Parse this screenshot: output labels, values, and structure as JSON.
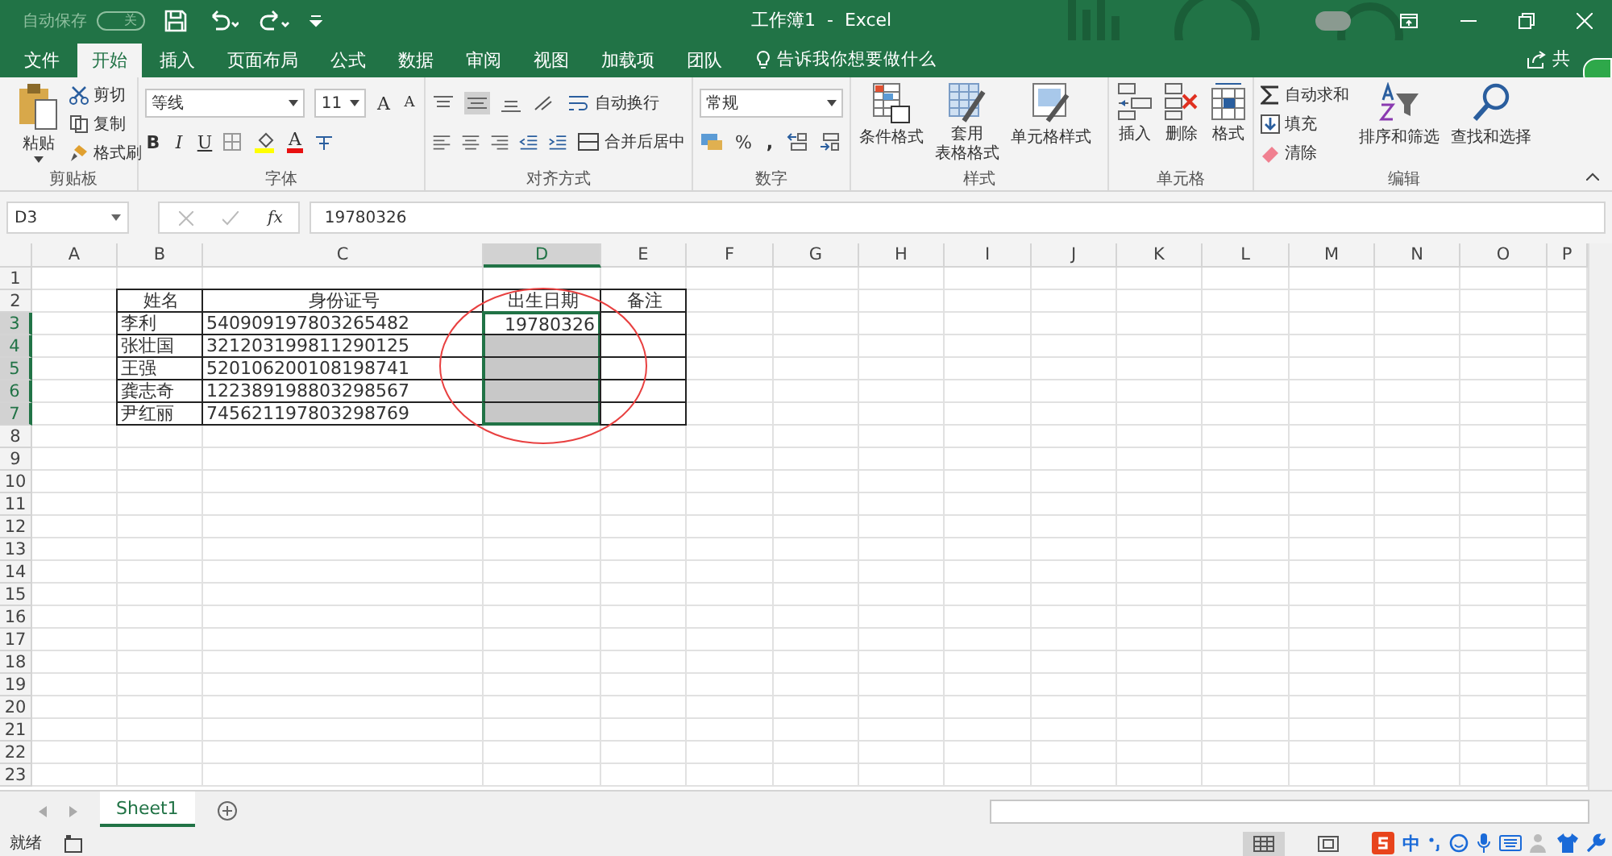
{
  "title_bar": {
    "autosave_label": "自动保存",
    "autosave_toggle": "关",
    "autosave_on": false,
    "title": "工作簿1  -  Excel"
  },
  "tabs": [
    {
      "label": "文件",
      "selected": false
    },
    {
      "label": "开始",
      "selected": true
    },
    {
      "label": "插入",
      "selected": false
    },
    {
      "label": "页面布局",
      "selected": false
    },
    {
      "label": "公式",
      "selected": false
    },
    {
      "label": "数据",
      "selected": false
    },
    {
      "label": "审阅",
      "selected": false
    },
    {
      "label": "视图",
      "selected": false
    },
    {
      "label": "加载项",
      "selected": false
    },
    {
      "label": "团队",
      "selected": false
    }
  ],
  "tell_me": "告诉我你想要做什么",
  "share": "共",
  "clipboard": {
    "label": "剪贴板",
    "paste": "粘贴",
    "cut": "剪切",
    "copy": "复制",
    "format_painter": "格式刷"
  },
  "font": {
    "label": "字体",
    "font_name": "等线",
    "font_size": "11",
    "grow_font": "A",
    "shrink_font": "A",
    "bold": "B",
    "italic": "I",
    "underline": "U",
    "font_color": "A"
  },
  "alignment": {
    "label": "对齐方式",
    "wrap": "自动换行",
    "merge": "合并后居中"
  },
  "number": {
    "label": "数字",
    "format": "常规",
    "percent": "%",
    "comma": ","
  },
  "styles": {
    "label": "样式",
    "conditional": "条件格式",
    "table_format": [
      "套用",
      "表格格式"
    ],
    "cell_styles": "单元格样式"
  },
  "cells": {
    "label": "单元格",
    "insert": "插入",
    "delete": "删除",
    "format": "格式"
  },
  "editing": {
    "label": "编辑",
    "autosum": "自动求和",
    "fill": "填充",
    "clear": "清除",
    "sort": "排序和筛选",
    "find": "查找和选择"
  },
  "name_box": "D3",
  "fx_label": "fx",
  "formula": "19780326",
  "columns": [
    {
      "label": "A",
      "selected": false
    },
    {
      "label": "B",
      "selected": false
    },
    {
      "label": "C",
      "selected": false
    },
    {
      "label": "D",
      "selected": true
    },
    {
      "label": "E",
      "selected": false
    },
    {
      "label": "F",
      "selected": false
    },
    {
      "label": "G",
      "selected": false
    },
    {
      "label": "H",
      "selected": false
    },
    {
      "label": "I",
      "selected": false
    },
    {
      "label": "J",
      "selected": false
    },
    {
      "label": "K",
      "selected": false
    },
    {
      "label": "L",
      "selected": false
    },
    {
      "label": "M",
      "selected": false
    },
    {
      "label": "N",
      "selected": false
    },
    {
      "label": "O",
      "selected": false
    },
    {
      "label": "P",
      "selected": false
    }
  ],
  "row_headers": [
    {
      "label": "1",
      "selected": false
    },
    {
      "label": "2",
      "selected": false
    },
    {
      "label": "3",
      "selected": true
    },
    {
      "label": "4",
      "selected": true
    },
    {
      "label": "5",
      "selected": true
    },
    {
      "label": "6",
      "selected": true
    },
    {
      "label": "7",
      "selected": true
    },
    {
      "label": "8",
      "selected": false
    },
    {
      "label": "9",
      "selected": false
    },
    {
      "label": "10",
      "selected": false
    },
    {
      "label": "11",
      "selected": false
    },
    {
      "label": "12",
      "selected": false
    },
    {
      "label": "13",
      "selected": false
    },
    {
      "label": "14",
      "selected": false
    },
    {
      "label": "15",
      "selected": false
    },
    {
      "label": "16",
      "selected": false
    },
    {
      "label": "17",
      "selected": false
    },
    {
      "label": "18",
      "selected": false
    },
    {
      "label": "19",
      "selected": false
    },
    {
      "label": "20",
      "selected": false
    },
    {
      "label": "21",
      "selected": false
    },
    {
      "label": "22",
      "selected": false
    },
    {
      "label": "23",
      "selected": false
    }
  ],
  "table": {
    "headers": [
      "姓名",
      "身份证号",
      "出生日期",
      "备注"
    ],
    "rows": [
      {
        "name": "李利",
        "id": "540909197803265482",
        "birth": "19780326",
        "selected": true,
        "active": true
      },
      {
        "name": "张壮国",
        "id": "321203199811290125",
        "selected": true,
        "active": false
      },
      {
        "name": "王强",
        "id": "520106200108198741",
        "selected": true,
        "active": false
      },
      {
        "name": "龚志奇",
        "id": "122389198803298567",
        "selected": true,
        "active": false
      },
      {
        "name": "尹红丽",
        "id": "745621197803298769",
        "selected": true,
        "active": false
      }
    ]
  },
  "sheets": [
    {
      "label": "Sheet1",
      "selected": true
    }
  ],
  "status": "就绪",
  "ime_mode": "中"
}
